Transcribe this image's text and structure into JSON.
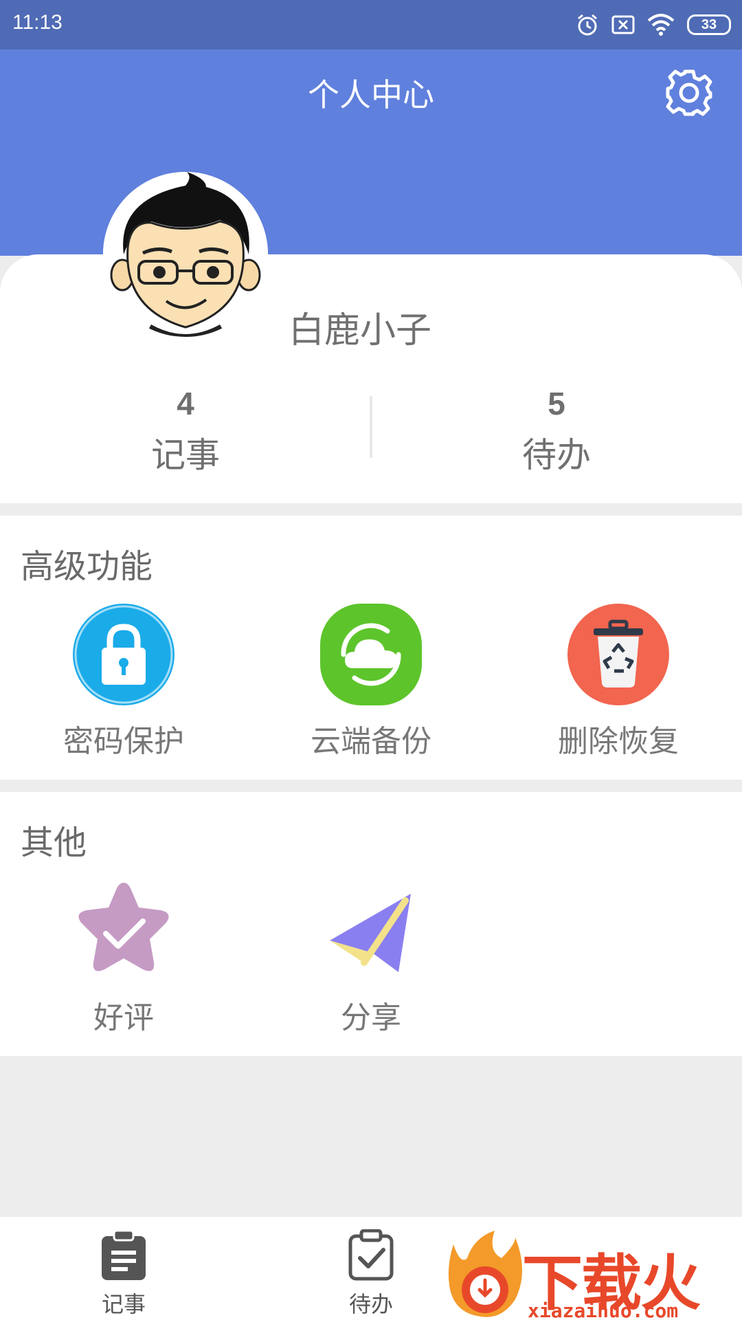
{
  "status_bar": {
    "time": "11:13",
    "battery": "33",
    "icons": [
      "alarm-icon",
      "sim-error-icon",
      "wifi-icon",
      "battery-icon"
    ]
  },
  "header": {
    "title": "个人中心",
    "settings_icon": "gear-icon"
  },
  "profile": {
    "username": "白鹿小子",
    "stats": [
      {
        "value": "4",
        "label": "记事"
      },
      {
        "value": "5",
        "label": "待办"
      }
    ]
  },
  "advanced": {
    "title": "高级功能",
    "items": [
      {
        "label": "密码保护",
        "icon": "lock-icon",
        "color": "#1aabe9"
      },
      {
        "label": "云端备份",
        "icon": "cloud-icon",
        "color": "#5dc42b"
      },
      {
        "label": "删除恢复",
        "icon": "recycle-bin-icon",
        "color": "#f2654f"
      }
    ]
  },
  "other": {
    "title": "其他",
    "items": [
      {
        "label": "好评",
        "icon": "star-check-icon",
        "color": "#c59bc4"
      },
      {
        "label": "分享",
        "icon": "paper-plane-icon",
        "color": "#8a7ff0"
      }
    ]
  },
  "bottom_nav": {
    "items": [
      {
        "label": "记事",
        "icon": "notes-clipboard-icon"
      },
      {
        "label": "待办",
        "icon": "todo-clipboard-icon"
      }
    ]
  },
  "watermark": {
    "text": "下载火",
    "url": "xiazaihuo.com"
  },
  "colors": {
    "status_bar": "#4f6bb5",
    "header": "#6080dd",
    "background": "#ededed"
  }
}
